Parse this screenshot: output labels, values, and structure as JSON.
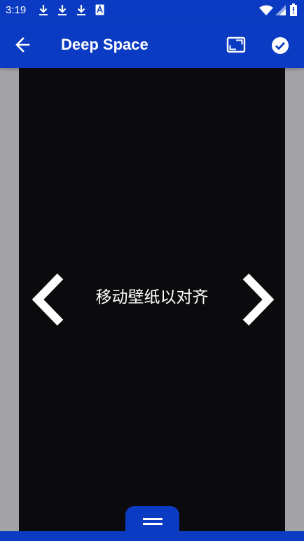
{
  "status_bar": {
    "time": "3:19",
    "left_icons": [
      "download-icon",
      "download-icon",
      "download-icon",
      "font-app-icon"
    ],
    "right_icons": [
      "wifi-icon",
      "signal-icon",
      "battery-icon"
    ]
  },
  "app_bar": {
    "title": "Deep Space",
    "back_icon": "arrow-left-icon",
    "crop_icon": "crop-free-icon",
    "apply_icon": "check-circle-icon"
  },
  "preview": {
    "hint": "移动壁纸以对齐",
    "left_icon": "chevron-left-icon",
    "right_icon": "chevron-right-icon"
  },
  "drawer": {
    "icon": "drag-handle-icon"
  },
  "colors": {
    "primary": "#0a3bc2",
    "preview_bg": "#0b0b0d",
    "page_bg": "#a3a3a6",
    "icon": "#ffffff"
  }
}
